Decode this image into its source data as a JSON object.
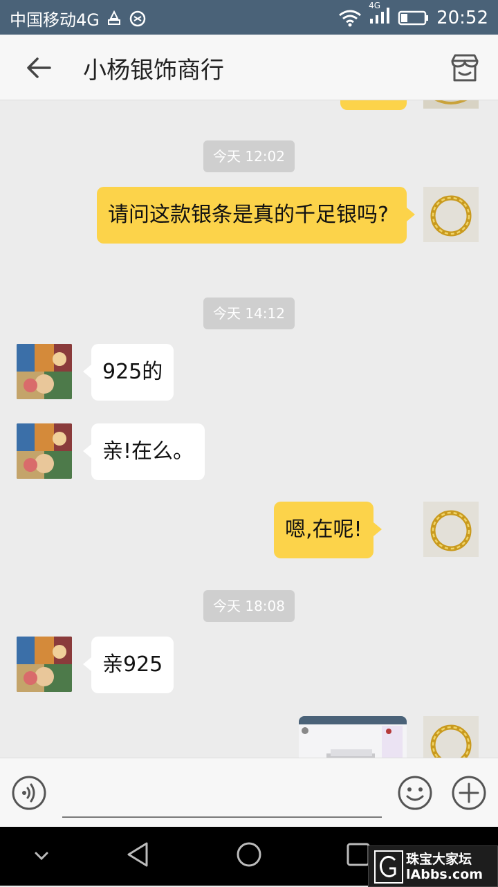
{
  "status_bar": {
    "carrier": "中国移动4G",
    "network": "4G",
    "time": "20:52"
  },
  "header": {
    "title": "小杨银饰商行"
  },
  "messages": [
    {
      "type": "timestamp",
      "text": "今天 12:02"
    },
    {
      "type": "outgoing",
      "text": "请问这款银条是真的千足银吗?"
    },
    {
      "type": "timestamp",
      "text": "今天 14:12"
    },
    {
      "type": "incoming",
      "text": "925的"
    },
    {
      "type": "incoming",
      "text": "亲!在么。"
    },
    {
      "type": "outgoing",
      "text": "嗯,在呢!"
    },
    {
      "type": "timestamp",
      "text": "今天 18:08"
    },
    {
      "type": "incoming",
      "text": "亲925"
    },
    {
      "type": "outgoing-image",
      "text": ""
    }
  ],
  "input": {
    "value": "",
    "placeholder": ""
  },
  "icons": {
    "back": "back-arrow-icon",
    "store": "store-icon",
    "voice": "voice-icon",
    "emoji": "emoji-icon",
    "plus": "plus-icon"
  },
  "colors": {
    "status_bar": "#4a6278",
    "outgoing_bubble": "#fcd34a",
    "incoming_bubble": "#ffffff",
    "chat_background": "#ececec"
  },
  "watermark": {
    "line1": "珠宝大家坛",
    "line2": "lAbbs.com"
  }
}
